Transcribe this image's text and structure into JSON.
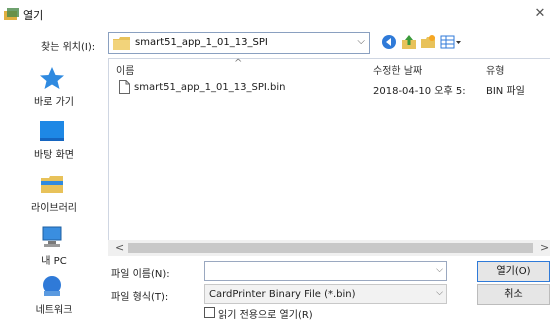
{
  "window": {
    "title": "열기",
    "close_glyph": "✕"
  },
  "lookin": {
    "label": "찾는 위치(I):",
    "value": "smart51_app_1_01_13_SPI",
    "arrow": "⌵"
  },
  "toolbar": {
    "icons": [
      "back-icon",
      "up-folder-icon",
      "new-folder-icon",
      "view-menu-icon"
    ]
  },
  "places": [
    {
      "label": "바로 가기",
      "icon": "star-icon"
    },
    {
      "label": "바탕 화면",
      "icon": "desktop-icon"
    },
    {
      "label": "라이브러리",
      "icon": "library-icon"
    },
    {
      "label": "내 PC",
      "icon": "computer-icon"
    },
    {
      "label": "네트워크",
      "icon": "network-icon"
    }
  ],
  "columns": {
    "name": "이름",
    "modified": "수정한 날짜",
    "type": "유형",
    "sort_caret": "^"
  },
  "files": [
    {
      "name": "smart51_app_1_01_13_SPI.bin",
      "modified": "2018-04-10 오후 5:",
      "type": "BIN 파일"
    }
  ],
  "scroll": {
    "left": "<",
    "right": ">"
  },
  "filename": {
    "label": "파일 이름(N):",
    "value": "",
    "arrow": "⌵"
  },
  "filetype": {
    "label": "파일 형식(T):",
    "value": "CardPrinter Binary File (*.bin)",
    "arrow": "⌵"
  },
  "buttons": {
    "open": "열기(O)",
    "cancel": "취소"
  },
  "readonly": {
    "label": "읽기 전용으로 열기(R)",
    "checked": false
  },
  "colors": {
    "accent": "#2f7ad8",
    "folder": "#e8c25a",
    "selection_border": "#8aa0c0"
  }
}
